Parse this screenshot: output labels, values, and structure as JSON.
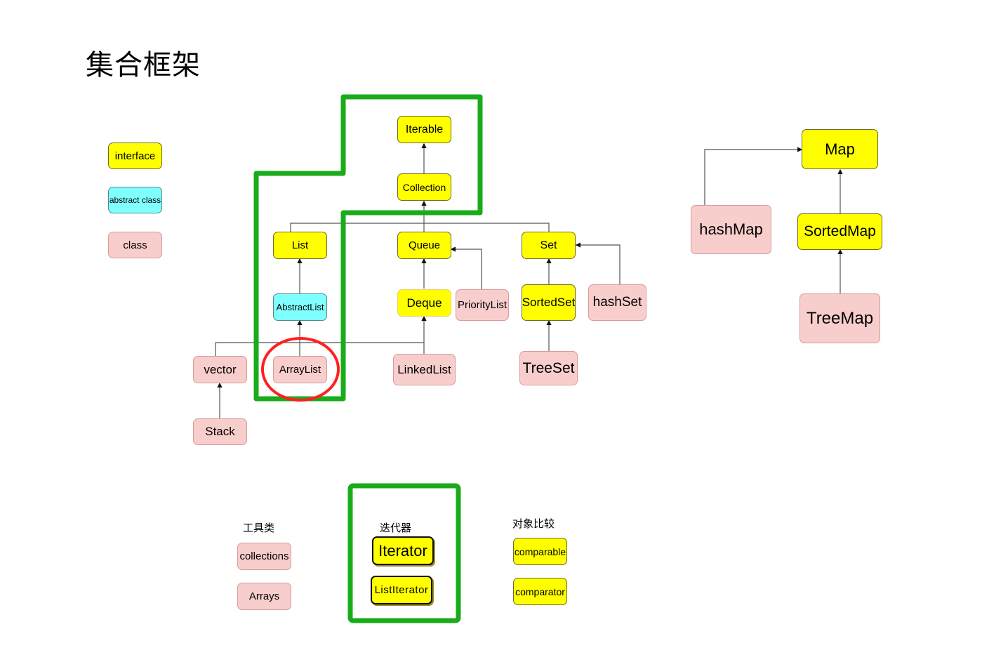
{
  "title": "集合框架",
  "legend": {
    "interface": "interface",
    "abstract_class": "abstract class",
    "class": "class"
  },
  "colors": {
    "interface": "#ffff00",
    "abstract_class": "#80ffff",
    "class": "#f8cecc",
    "highlight_green": "#1aab1a",
    "highlight_red": "#ff2020"
  },
  "collection_tree": {
    "iterable": "Iterable",
    "collection": "Collection",
    "list": "List",
    "queue": "Queue",
    "set": "Set",
    "abstract_list": "AbstractList",
    "deque": "Deque",
    "priority_list": "PriorityList",
    "sorted_set": "SortedSet",
    "hash_set": "hashSet",
    "vector": "vector",
    "array_list": "ArrayList",
    "linked_list": "LinkedList",
    "tree_set": "TreeSet",
    "stack": "Stack"
  },
  "map_tree": {
    "map": "Map",
    "hash_map": "hashMap",
    "sorted_map": "SortedMap",
    "tree_map": "TreeMap"
  },
  "utilities": {
    "heading": "工具类",
    "items": [
      "collections",
      "Arrays"
    ]
  },
  "iterators": {
    "heading": "迭代器",
    "items": [
      "Iterator",
      "ListIterator"
    ]
  },
  "comparison": {
    "heading": "对象比较",
    "items": [
      "comparable",
      "comparator"
    ]
  }
}
